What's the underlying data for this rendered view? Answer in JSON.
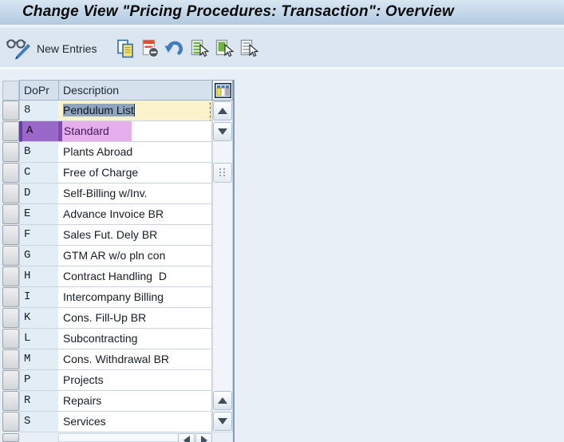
{
  "window": {
    "title": "Change View \"Pricing Procedures: Transaction\": Overview"
  },
  "toolbar": {
    "new_entries_label": "New Entries",
    "change_display_icon": "display-change-icon",
    "action_icons": [
      "copy-as-icon",
      "delete-icon",
      "undo-icon",
      "select-all-icon",
      "select-block-icon",
      "deselect-all-icon"
    ]
  },
  "table": {
    "columns": [
      {
        "key": "dopr",
        "label": "DoPr"
      },
      {
        "key": "description",
        "label": "Description"
      }
    ],
    "config_icon": "table-configuration-icon",
    "rows": [
      {
        "dopr": "8",
        "description": "Pendulum List",
        "state": "editing"
      },
      {
        "dopr": "A",
        "description": "Standard",
        "state": "selected"
      },
      {
        "dopr": "B",
        "description": "Plants Abroad",
        "state": "normal"
      },
      {
        "dopr": "C",
        "description": "Free of Charge",
        "state": "normal"
      },
      {
        "dopr": "D",
        "description": "Self-Billing w/Inv.",
        "state": "normal"
      },
      {
        "dopr": "E",
        "description": "Advance Invoice BR",
        "state": "normal"
      },
      {
        "dopr": "F",
        "description": "Sales Fut. Dely BR",
        "state": "normal"
      },
      {
        "dopr": "G",
        "description": "GTM AR w/o pln con",
        "state": "normal"
      },
      {
        "dopr": "H",
        "description": "Contract Handling  D",
        "state": "normal"
      },
      {
        "dopr": "I",
        "description": "Intercompany Billing",
        "state": "normal"
      },
      {
        "dopr": "K",
        "description": "Cons. Fill-Up BR",
        "state": "normal"
      },
      {
        "dopr": "L",
        "description": "Subcontracting",
        "state": "normal"
      },
      {
        "dopr": "M",
        "description": "Cons. Withdrawal BR",
        "state": "normal"
      },
      {
        "dopr": "P",
        "description": "Projects",
        "state": "normal"
      },
      {
        "dopr": "R",
        "description": "Repairs",
        "state": "normal"
      },
      {
        "dopr": "S",
        "description": "Services",
        "state": "normal"
      }
    ]
  },
  "colors": {
    "titlebar": "#c2d6e9",
    "toolbar": "#dbe6f0",
    "selected_dopr_bg": "#9a68c9",
    "selected_desc_bg": "#e7aeee",
    "editing_cell_bg": "#fcf2cb",
    "text_selection_bg": "#8fa5bd",
    "focus_border": "#d3302a",
    "accent_blue": "#3e7dbd",
    "green_icon": "#70b33e"
  }
}
